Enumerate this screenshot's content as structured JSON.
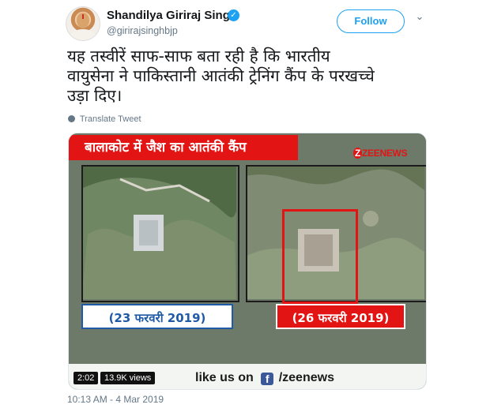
{
  "tweet": {
    "author_name": "Shandilya Giriraj Singh",
    "handle": "@girirajsinghbjp",
    "follow_label": "Follow",
    "text_lines": [
      "यह तस्वीरें साफ-साफ बता रही है कि भारतीय",
      "वायुसेना ने पाकिस्तानी आतंकी ट्रेनिंग कैंप के परखच्चे",
      "उड़ा दिए।"
    ],
    "translate_label": "Translate Tweet",
    "timestamp": "10:13 AM - 4 Mar 2019"
  },
  "media": {
    "banner": "बालाकोट में जैश का आतंकी कैंप",
    "logo_text": "ZEENEWS",
    "date_left": "(23 फरवरी 2019)",
    "date_right": "(26 फरवरी 2019)",
    "time": "2:02",
    "views": "13.9K views",
    "like_prefix": "like us on",
    "like_suffix": "/zeenews"
  },
  "icons": {
    "verified": "verified-badge-icon",
    "caret": "chevron-down-icon",
    "globe": "globe-icon",
    "facebook": "facebook-icon"
  },
  "colors": {
    "twitter_blue": "#1da1f2",
    "banner_red": "#e21414",
    "date_blue": "#1f5aa6",
    "muted": "#657786"
  }
}
